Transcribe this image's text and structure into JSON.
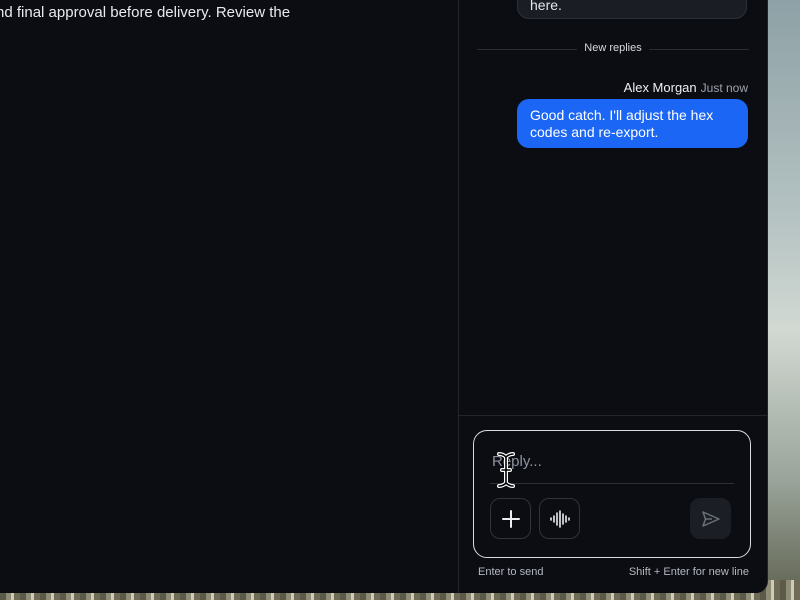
{
  "document": {
    "body_text": "nd final approval before delivery. Review the"
  },
  "thread": {
    "previous_message_fragment": "here.",
    "divider_label": "New replies",
    "messages": [
      {
        "author": "Alex Morgan",
        "time": "Just now",
        "text": "Good catch. I'll adjust the hex codes and re-export."
      }
    ]
  },
  "composer": {
    "placeholder": "Reply...",
    "value": "",
    "attach_icon": "plus-icon",
    "voice_icon": "audio-waveform-icon",
    "send_icon": "send-icon",
    "hint_left": "Enter to send",
    "hint_right": "Shift + Enter for new line"
  },
  "colors": {
    "accent": "#1c66f5",
    "background": "#0b0d13"
  }
}
